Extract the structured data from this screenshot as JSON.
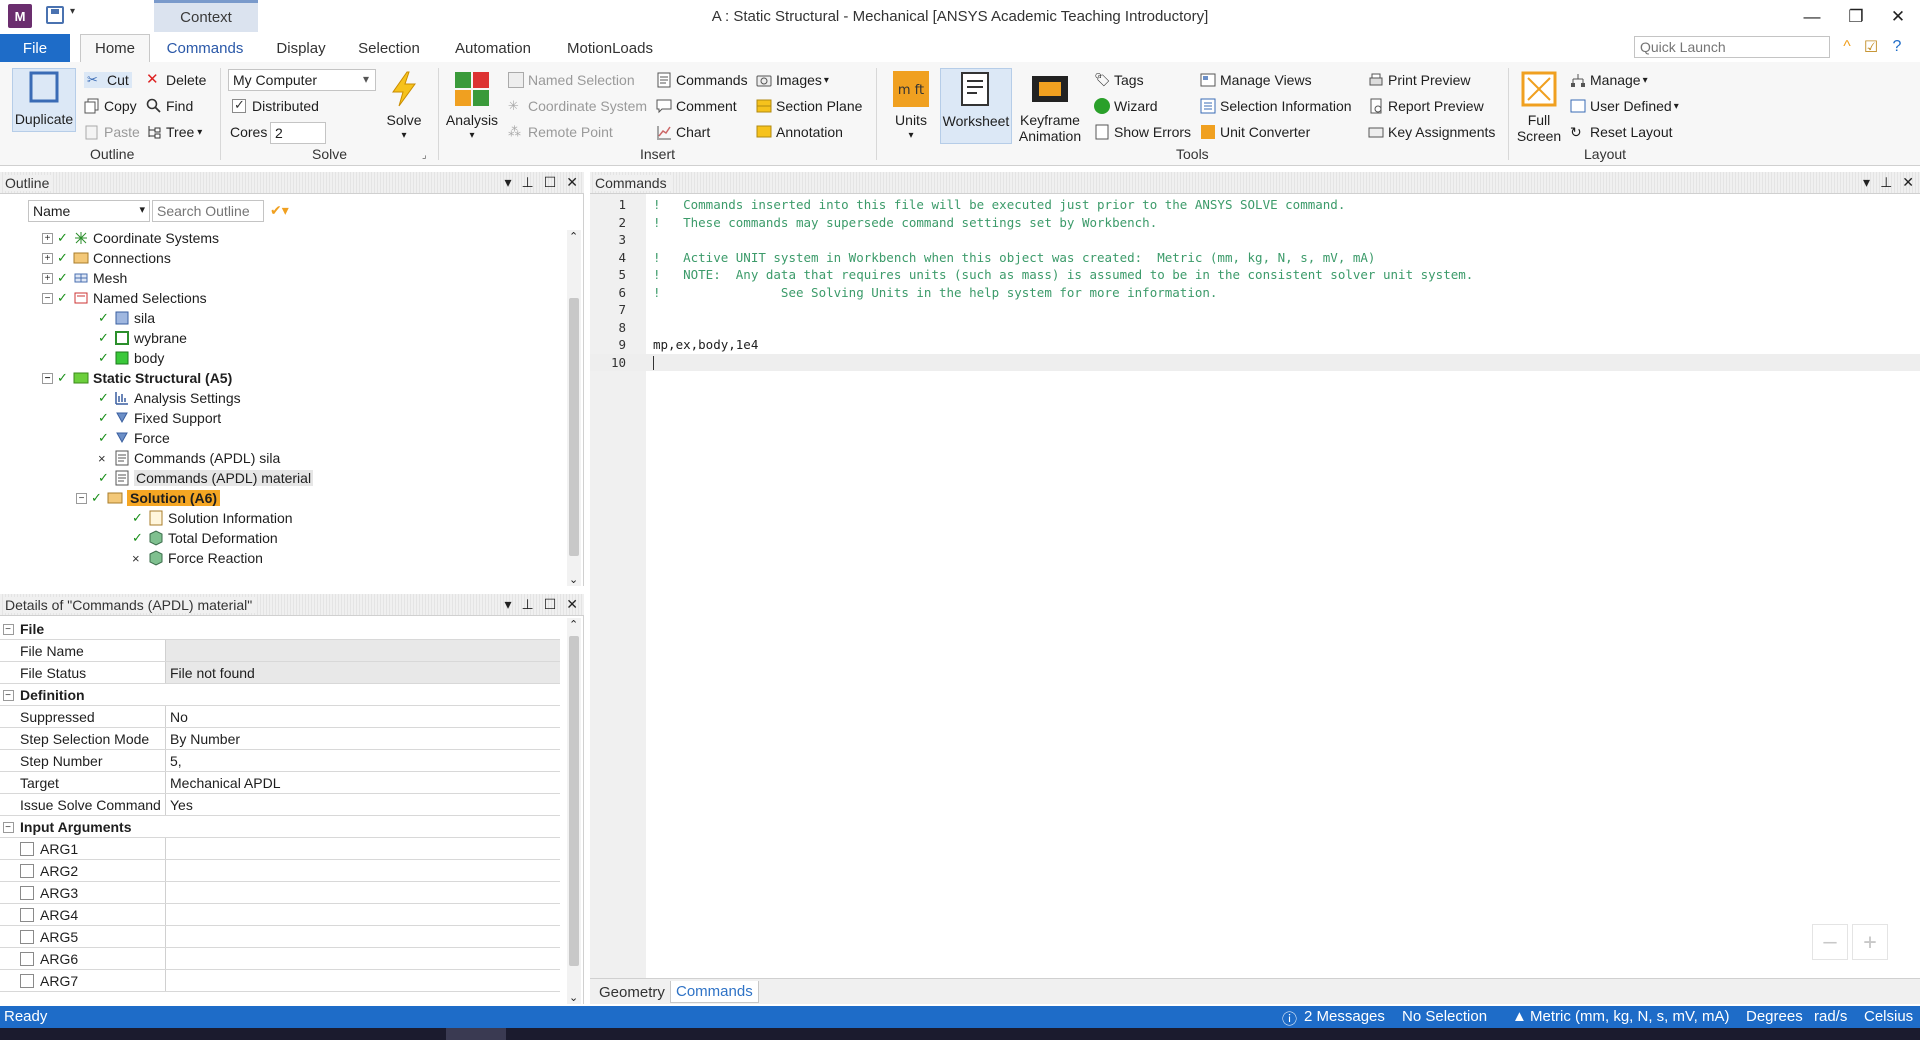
{
  "window": {
    "title": "A : Static Structural - Mechanical [ANSYS Academic Teaching Introductory]",
    "app_logo": "M",
    "context_tab": "Context"
  },
  "ribbon_tabs": {
    "file": "File",
    "tabs": [
      "Home",
      "Commands",
      "Display",
      "Selection",
      "Automation",
      "MotionLoads"
    ],
    "active": "Home",
    "quick_launch_placeholder": "Quick Launch"
  },
  "ribbon": {
    "outline": {
      "label": "Outline",
      "duplicate": "Duplicate",
      "cut": "Cut",
      "copy": "Copy",
      "paste": "Paste",
      "delete": "Delete",
      "find": "Find",
      "tree": "Tree"
    },
    "solve": {
      "label": "Solve",
      "machine": "My Computer",
      "distributed": "Distributed",
      "cores_label": "Cores",
      "cores_value": "2",
      "solve_button": "Solve",
      "analysis": "Analysis"
    },
    "insert": {
      "label": "Insert",
      "named_selection": "Named Selection",
      "coordinate_system": "Coordinate System",
      "remote_point": "Remote Point",
      "commands": "Commands",
      "comment": "Comment",
      "chart": "Chart",
      "images": "Images",
      "section_plane": "Section Plane",
      "annotation": "Annotation"
    },
    "tools": {
      "label": "Tools",
      "units": "Units",
      "worksheet": "Worksheet",
      "keyframe": "Keyframe\nAnimation",
      "tags": "Tags",
      "wizard": "Wizard",
      "show_errors": "Show Errors",
      "manage_views": "Manage Views",
      "selection_information": "Selection Information",
      "unit_converter": "Unit Converter",
      "print_preview": "Print Preview",
      "report_preview": "Report Preview",
      "key_assignments": "Key Assignments"
    },
    "layout": {
      "label": "Layout",
      "full_screen": "Full\nScreen",
      "manage": "Manage",
      "user_defined": "User Defined",
      "reset_layout": "Reset Layout"
    }
  },
  "outline_panel": {
    "title": "Outline",
    "filter_value": "Name",
    "search_placeholder": "Search Outline",
    "tree": [
      {
        "label": "Coordinate Systems",
        "state": "ok"
      },
      {
        "label": "Connections",
        "state": "ok"
      },
      {
        "label": "Mesh",
        "state": "ok"
      },
      {
        "label": "Named Selections",
        "state": "ok"
      },
      {
        "label": "sila",
        "state": "ok"
      },
      {
        "label": "wybrane",
        "state": "ok"
      },
      {
        "label": "body",
        "state": "ok"
      },
      {
        "label": "Static Structural (A5)",
        "state": "ok"
      },
      {
        "label": "Analysis Settings",
        "state": "ok"
      },
      {
        "label": "Fixed Support",
        "state": "ok"
      },
      {
        "label": "Force",
        "state": "ok"
      },
      {
        "label": "Commands (APDL) sila",
        "state": "suppressed"
      },
      {
        "label": "Commands (APDL) material",
        "state": "ok"
      },
      {
        "label": "Solution (A6)",
        "state": "ok"
      },
      {
        "label": "Solution Information",
        "state": "ok"
      },
      {
        "label": "Total Deformation",
        "state": "ok"
      },
      {
        "label": "Force Reaction",
        "state": "suppressed"
      }
    ]
  },
  "details_panel": {
    "title": "Details of \"Commands (APDL) material\"",
    "sections": {
      "file": "File",
      "definition": "Definition",
      "input_arguments": "Input Arguments"
    },
    "rows": {
      "file_name_k": "File Name",
      "file_name_v": "",
      "file_status_k": "File Status",
      "file_status_v": "File not found",
      "suppressed_k": "Suppressed",
      "suppressed_v": "No",
      "step_mode_k": "Step Selection Mode",
      "step_mode_v": "By Number",
      "step_number_k": "Step Number",
      "step_number_v": "5,",
      "target_k": "Target",
      "target_v": "Mechanical APDL",
      "issue_k": "Issue Solve Command",
      "issue_v": "Yes"
    },
    "args": [
      "ARG1",
      "ARG2",
      "ARG3",
      "ARG4",
      "ARG5",
      "ARG6",
      "ARG7"
    ]
  },
  "commands_panel": {
    "title": "Commands",
    "lines": [
      {
        "n": "1",
        "text": "!   Commands inserted into this file will be executed just prior to the ANSYS SOLVE command.",
        "comment": true
      },
      {
        "n": "2",
        "text": "!   These commands may supersede command settings set by Workbench.",
        "comment": true
      },
      {
        "n": "3",
        "text": "",
        "comment": false
      },
      {
        "n": "4",
        "text": "!   Active UNIT system in Workbench when this object was created:  Metric (mm, kg, N, s, mV, mA)",
        "comment": true
      },
      {
        "n": "5",
        "text": "!   NOTE:  Any data that requires units (such as mass) is assumed to be in the consistent solver unit system.",
        "comment": true
      },
      {
        "n": "6",
        "text": "!                See Solving Units in the help system for more information.",
        "comment": true
      },
      {
        "n": "7",
        "text": "",
        "comment": false
      },
      {
        "n": "8",
        "text": "",
        "comment": false
      },
      {
        "n": "9",
        "text": "mp,ex,body,1e4",
        "comment": false
      },
      {
        "n": "10",
        "text": "",
        "comment": false
      }
    ],
    "bottom_tabs": [
      "Geometry",
      "Commands"
    ],
    "active_tab": "Commands",
    "zoom_out": "–",
    "zoom_in": "+"
  },
  "statusbar": {
    "ready": "Ready",
    "messages": "2 Messages",
    "selection": "No Selection",
    "units": "Metric (mm, kg, N, s, mV, mA)",
    "angle": "Degrees",
    "rate": "rad/s",
    "temperature": "Celsius"
  },
  "colors": {
    "accent": "#1e6cc8",
    "selected_node": "#f5a623",
    "comment": "#3c9b6a",
    "ok_check": "#1a8f1a"
  }
}
